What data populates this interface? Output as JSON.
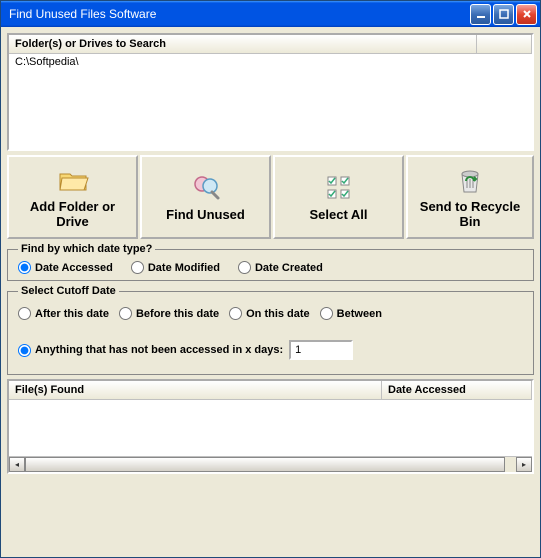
{
  "window": {
    "title": "Find Unused Files Software"
  },
  "folders": {
    "header": "Folder(s) or Drives to Search",
    "items": [
      "C:\\Softpedia\\"
    ]
  },
  "toolbar": {
    "add_folder": "Add Folder or Drive",
    "find_unused": "Find Unused",
    "select_all": "Select All",
    "recycle": "Send to Recycle Bin"
  },
  "date_type": {
    "legend": "Find by which date type?",
    "options": {
      "accessed": "Date Accessed",
      "modified": "Date Modified",
      "created": "Date Created"
    },
    "selected": "accessed"
  },
  "cutoff": {
    "legend": "Select Cutoff Date",
    "options": {
      "after": "After this date",
      "before": "Before this date",
      "on": "On this date",
      "between": "Between",
      "not_accessed": "Anything that has not been accessed in x days:"
    },
    "selected": "not_accessed",
    "days_value": "1"
  },
  "results": {
    "col_files": "File(s) Found",
    "col_date": "Date Accessed"
  }
}
